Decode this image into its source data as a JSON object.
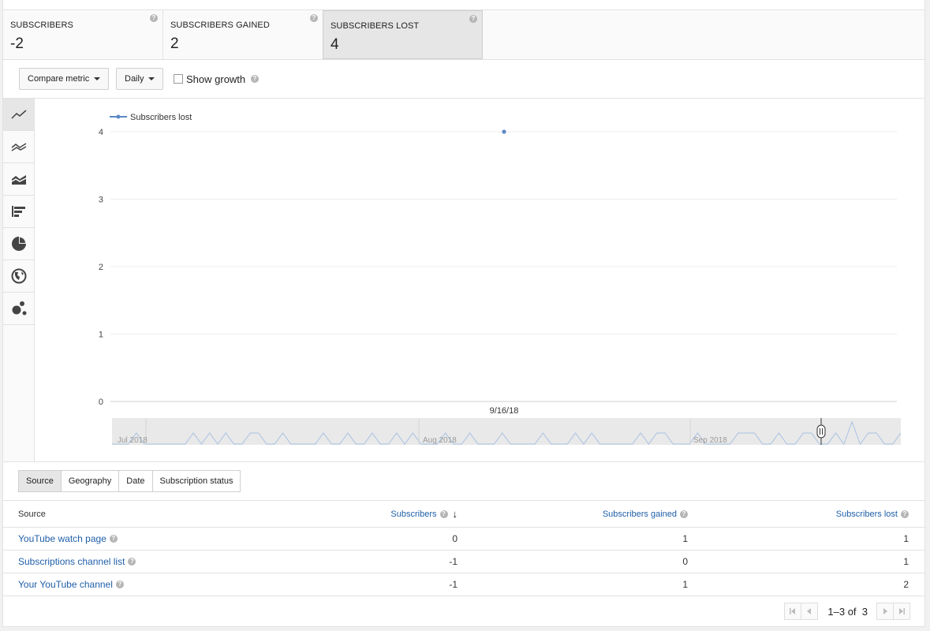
{
  "metrics": [
    {
      "label": "SUBSCRIBERS",
      "value": "-2",
      "active": false
    },
    {
      "label": "SUBSCRIBERS GAINED",
      "value": "2",
      "active": false
    },
    {
      "label": "SUBSCRIBERS LOST",
      "value": "4",
      "active": true
    }
  ],
  "controls": {
    "compare_label": "Compare metric",
    "interval_label": "Daily",
    "show_growth_label": "Show growth",
    "show_growth_checked": false
  },
  "chart_tools": [
    "line-chart-icon",
    "multi-line-chart-icon",
    "stacked-area-chart-icon",
    "bar-chart-icon",
    "pie-chart-icon",
    "globe-map-icon",
    "bubble-chart-icon"
  ],
  "chart_data": {
    "type": "line",
    "legend": "Subscribers lost",
    "ylim": [
      0,
      4
    ],
    "yticks": [
      "0",
      "1",
      "2",
      "3",
      "4"
    ],
    "x_label_selected": "9/16/18",
    "points": [
      {
        "x": "9/16/18",
        "y": 4
      }
    ],
    "grid": true,
    "legend_position": "top-left",
    "overview": {
      "months": [
        "Jul 2018",
        "Aug 2018",
        "Sep 2018"
      ],
      "daily_values": [
        0,
        0,
        0,
        1,
        0,
        0,
        0,
        0,
        0,
        0,
        1,
        0,
        1,
        0,
        1,
        0,
        0,
        1,
        1,
        0,
        0,
        1,
        0,
        0,
        0,
        0,
        1,
        0,
        0,
        1,
        0,
        0,
        1,
        0,
        0,
        1,
        0,
        1,
        0,
        0,
        0,
        1,
        0,
        0,
        1,
        0,
        0,
        0,
        1,
        0,
        0,
        0,
        0,
        1,
        0,
        0,
        0,
        1,
        0,
        1,
        0,
        0,
        0,
        0,
        0,
        1,
        0,
        1,
        1,
        0,
        0,
        0,
        1,
        0,
        0,
        0,
        0,
        1,
        1,
        1,
        0,
        0,
        1,
        0,
        0,
        1,
        1,
        0,
        0,
        1,
        0,
        2,
        0,
        1,
        1,
        0,
        0,
        1
      ]
    },
    "color": "#5a88c5"
  },
  "tabs": [
    "Source",
    "Geography",
    "Date",
    "Subscription status"
  ],
  "active_tab": "Source",
  "table": {
    "headers": {
      "source": "Source",
      "subscribers": "Subscribers",
      "gained": "Subscribers gained",
      "lost": "Subscribers lost"
    },
    "rows": [
      {
        "source": "YouTube watch page",
        "subscribers": "0",
        "gained": "1",
        "lost": "1"
      },
      {
        "source": "Subscriptions channel list",
        "subscribers": "-1",
        "gained": "0",
        "lost": "1"
      },
      {
        "source": "Your YouTube channel",
        "subscribers": "-1",
        "gained": "1",
        "lost": "2"
      }
    ]
  },
  "pagination": {
    "range": "1–3",
    "of_label": "of",
    "total": "3"
  }
}
